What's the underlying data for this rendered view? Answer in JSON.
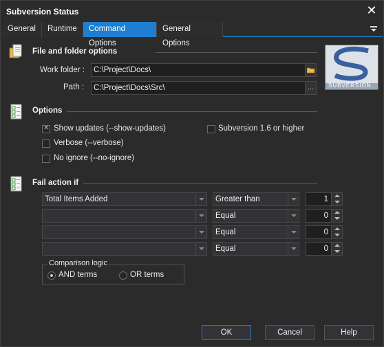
{
  "window": {
    "title": "Subversion Status"
  },
  "tabs": [
    {
      "label": "General"
    },
    {
      "label": "Runtime"
    },
    {
      "label": "Command Options"
    },
    {
      "label": "General Options"
    }
  ],
  "file_folder": {
    "title": "File and folder options",
    "work_folder_label": "Work folder :",
    "work_folder_value": "C:\\Project\\Docs\\",
    "path_label": "Path :",
    "path_value": "C:\\Project\\Docs\\Src\\",
    "logo_text": "SUBVERSION"
  },
  "options": {
    "title": "Options",
    "show_updates": {
      "label": "Show updates (--show-updates)",
      "checked": true
    },
    "svn16": {
      "label": "Subversion 1.6 or higher",
      "checked": false
    },
    "verbose": {
      "label": "Verbose (--verbose)",
      "checked": false
    },
    "no_ignore": {
      "label": "No ignore (--no-ignore)",
      "checked": false
    }
  },
  "fail_action": {
    "title": "Fail action if",
    "rows": [
      {
        "field": "Total Items Added",
        "operator": "Greater than",
        "value": "1"
      },
      {
        "field": "",
        "operator": "Equal",
        "value": "0"
      },
      {
        "field": "",
        "operator": "Equal",
        "value": "0"
      },
      {
        "field": "",
        "operator": "Equal",
        "value": "0"
      }
    ],
    "comparison_logic": {
      "title": "Comparison logic",
      "and_label": "AND terms",
      "or_label": "OR terms",
      "selected": "AND"
    }
  },
  "buttons": {
    "ok": "OK",
    "cancel": "Cancel",
    "help": "Help"
  },
  "colors": {
    "accent": "#1e7fd0",
    "background": "#2b2b2b"
  }
}
